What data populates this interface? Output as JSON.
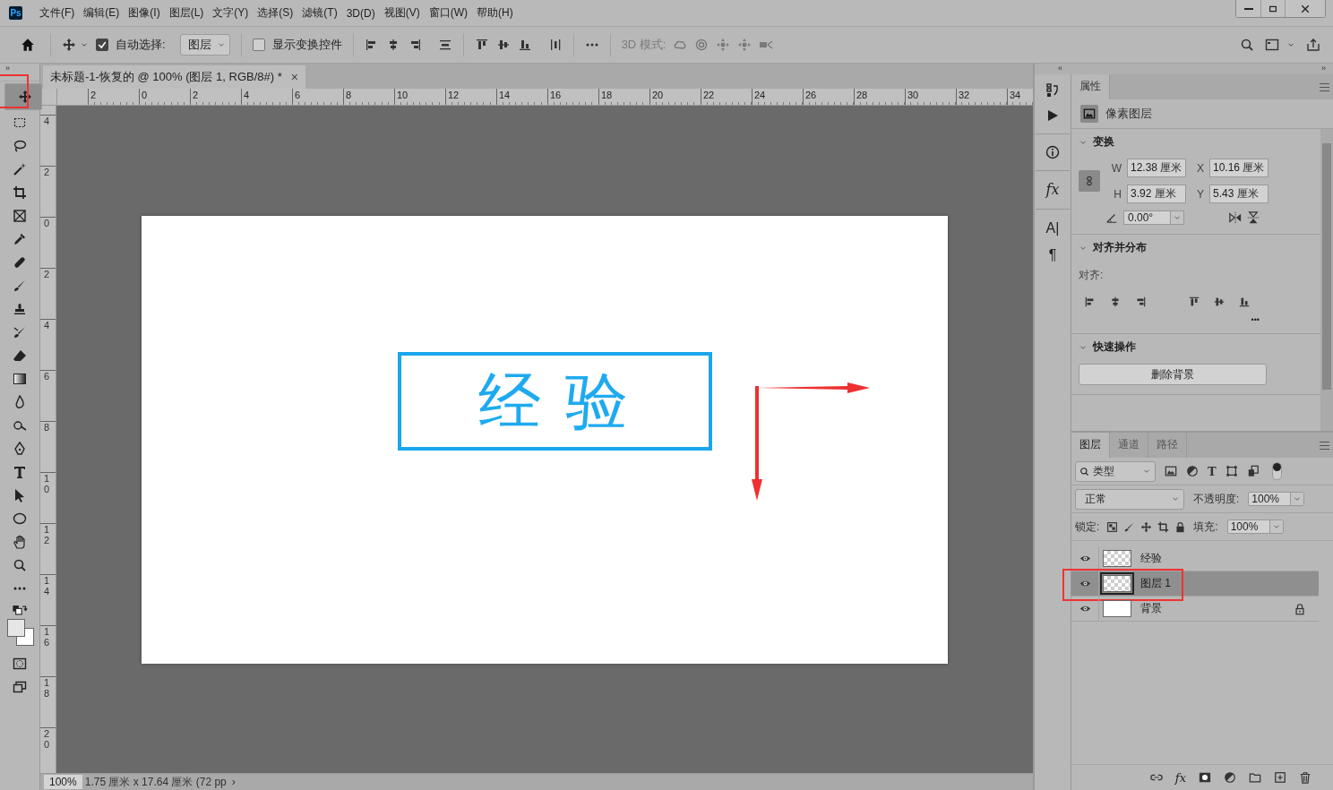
{
  "app": {
    "logo": "Ps"
  },
  "menu": [
    "文件(F)",
    "编辑(E)",
    "图像(I)",
    "图层(L)",
    "文字(Y)",
    "选择(S)",
    "滤镜(T)",
    "3D(D)",
    "视图(V)",
    "窗口(W)",
    "帮助(H)"
  ],
  "collapse": {
    "toolbar": "»",
    "panels_left": "«",
    "panels_right": "»"
  },
  "options_bar": {
    "auto_select": {
      "label": "自动选择:",
      "checked": true
    },
    "target": "图层",
    "show_transform": {
      "label": "显示变换控件",
      "checked": false
    },
    "mode_3d": "3D 模式:"
  },
  "document_tab": {
    "title": "未标题-1-恢复的 @ 100% (图层 1, RGB/8#) *",
    "close": "×"
  },
  "ruler_h": [
    "2",
    "0",
    "2",
    "4",
    "6",
    "8",
    "10",
    "12",
    "14",
    "16",
    "18",
    "20",
    "22",
    "24",
    "26",
    "28",
    "30",
    "32",
    "34"
  ],
  "ruler_v": [
    "4",
    "2",
    "0",
    "2",
    "4",
    "6",
    "8",
    "10",
    "12",
    "14",
    "16",
    "18",
    "20"
  ],
  "tools": [
    {
      "kind": "move",
      "selected": true,
      "annotated": true
    },
    {
      "kind": "marquee",
      "selected": false,
      "annotated": false
    },
    {
      "kind": "lasso",
      "selected": false,
      "annotated": false
    },
    {
      "kind": "wand",
      "selected": false,
      "annotated": false
    },
    {
      "kind": "crop",
      "selected": false,
      "annotated": false
    },
    {
      "kind": "frame",
      "selected": false,
      "annotated": false
    },
    {
      "kind": "eyedropper",
      "selected": false,
      "annotated": false
    },
    {
      "kind": "bandage",
      "selected": false,
      "annotated": false
    },
    {
      "kind": "brush",
      "selected": false,
      "annotated": false
    },
    {
      "kind": "stamp",
      "selected": false,
      "annotated": false
    },
    {
      "kind": "history",
      "selected": false,
      "annotated": false
    },
    {
      "kind": "eraser",
      "selected": false,
      "annotated": false
    },
    {
      "kind": "gradient",
      "selected": false,
      "annotated": false
    },
    {
      "kind": "drop",
      "selected": false,
      "annotated": false
    },
    {
      "kind": "dodge",
      "selected": false,
      "annotated": false
    },
    {
      "kind": "pen",
      "selected": false,
      "annotated": false
    },
    {
      "kind": "type",
      "selected": false,
      "annotated": false
    },
    {
      "kind": "select",
      "selected": false,
      "annotated": false
    },
    {
      "kind": "ellipse",
      "selected": false,
      "annotated": false
    },
    {
      "kind": "hand",
      "selected": false,
      "annotated": false
    },
    {
      "kind": "zoom",
      "selected": false,
      "annotated": false
    },
    {
      "kind": "more",
      "selected": false,
      "annotated": false
    }
  ],
  "canvas": {
    "text": "经 验"
  },
  "strip": [
    {
      "kind": "history"
    },
    {
      "kind": "play"
    },
    {
      "kind": "info"
    },
    {
      "kind": "glyph",
      "glyph": "fx"
    },
    {
      "kind": "glyph",
      "glyph": "A|"
    },
    {
      "kind": "glyph",
      "glyph": "¶"
    }
  ],
  "properties": {
    "tab": "属性",
    "layer_type": "像素图层",
    "sections": [
      {
        "kind": "transform",
        "title": "变换",
        "expanded": true,
        "w_label": "W",
        "w": "12.38 厘米",
        "x_label": "X",
        "x": "10.16 厘米",
        "h_label": "H",
        "h": "3.92 厘米",
        "y_label": "Y",
        "y": "5.43 厘米",
        "angle": "0.00°"
      },
      {
        "kind": "align",
        "title": "对齐并分布",
        "expanded": true,
        "label": "对齐:",
        "more": "•••"
      },
      {
        "kind": "quick",
        "title": "快速操作",
        "expanded": true,
        "button": "删除背景"
      }
    ]
  },
  "layers_panel": {
    "tabs": [
      {
        "label": "图层",
        "selected": true
      },
      {
        "label": "通道",
        "selected": false
      },
      {
        "label": "路径",
        "selected": false
      }
    ],
    "filter": "类型",
    "filter_type_glyph": "T",
    "blend": "正常",
    "opacity_label": "不透明度:",
    "opacity": "100%",
    "lock_label": "锁定:",
    "fill_label": "填充:",
    "fill": "100%",
    "layers": [
      {
        "name": "经验",
        "visible": true,
        "selected": false,
        "locked": false,
        "annotated": false,
        "transparent": true
      },
      {
        "name": "图层 1",
        "visible": true,
        "selected": true,
        "locked": false,
        "annotated": true,
        "transparent": true
      },
      {
        "name": "背景",
        "visible": true,
        "selected": false,
        "locked": true,
        "annotated": false,
        "transparent": false
      }
    ],
    "fx_glyph": "fx"
  },
  "status_bar": {
    "zoom": "100%",
    "info": "1.75 厘米 x 17.64 厘米 (72 pp",
    "more": "›"
  }
}
